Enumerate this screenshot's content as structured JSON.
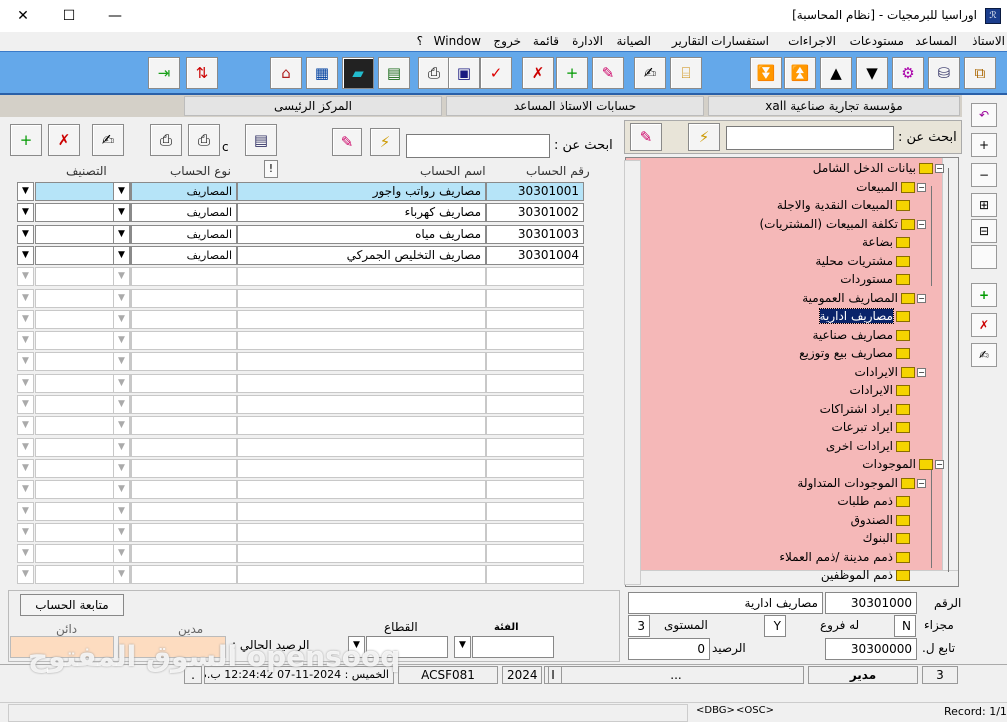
{
  "window": {
    "title": "اوراسيا للبرمجيات - [نظام المحاسبة]",
    "app_icon": "ℛ"
  },
  "menu": [
    "الاستاذ",
    "المساعد",
    "مستودعات",
    "الاجراءات",
    "استفسارات",
    "التقارير",
    "الصيانة",
    "الادارة",
    "قائمة",
    "خروج",
    "Window",
    "؟"
  ],
  "headers": {
    "left": "المركز الرئيسى",
    "middle": "حسابات الاستاذ المساعد",
    "right": "مؤسسة تجارية صناعية xall"
  },
  "search_label_right": "ابحث عن :",
  "search_label_left": "ابحث عن :",
  "print_c": "c",
  "tree": [
    {
      "text": "بيانات الدخل الشامل",
      "level": 0,
      "folder": true
    },
    {
      "text": "المبيعات",
      "level": 1,
      "folder": true
    },
    {
      "text": "المبيعات النقدية والاجلة",
      "level": 2
    },
    {
      "text": "تكلفة المبيعات (المشتريات)",
      "level": 1,
      "folder": true
    },
    {
      "text": "بضاعة",
      "level": 2
    },
    {
      "text": "مشتريات محلية",
      "level": 2
    },
    {
      "text": "مستوردات",
      "level": 2
    },
    {
      "text": "المصاريف العمومية",
      "level": 1,
      "folder": true,
      "open": true
    },
    {
      "text": "مصاريف ادارية",
      "level": 2,
      "selected": true
    },
    {
      "text": "مصاريف صناعية",
      "level": 2
    },
    {
      "text": "مصاريف بيع وتوزيع",
      "level": 2
    },
    {
      "text": "الايرادات",
      "level": 1,
      "folder": true
    },
    {
      "text": "الايرادات",
      "level": 2
    },
    {
      "text": "ايراد اشتراكات",
      "level": 2
    },
    {
      "text": "ايراد تبرعات",
      "level": 2
    },
    {
      "text": "ايرادات اخرى",
      "level": 2
    },
    {
      "text": "الموجودات",
      "level": 0,
      "folder": true
    },
    {
      "text": "الموجودات المتداولة",
      "level": 1,
      "folder": true
    },
    {
      "text": "ذمم طلبات",
      "level": 2
    },
    {
      "text": "الصندوق",
      "level": 2
    },
    {
      "text": "البنوك",
      "level": 2
    },
    {
      "text": "ذمم مدينة /ذمم العملاء",
      "level": 2
    },
    {
      "text": "ذمم الموظفين",
      "level": 2
    }
  ],
  "grid": {
    "columns": {
      "number": "رقم الحساب",
      "name": "اسم الحساب",
      "type": "نوع الحساب",
      "class": "التصنيف"
    },
    "excl": "!",
    "rows": [
      {
        "number": "30301001",
        "name": "مصاريف رواتب واجور",
        "type": "المصاريف"
      },
      {
        "number": "30301002",
        "name": "مصاريف كهرباء",
        "type": "المصاريف"
      },
      {
        "number": "30301003",
        "name": "مصاريف مياه",
        "type": "المصاريف"
      },
      {
        "number": "30301004",
        "name": "مصاريف التخليص الجمركي",
        "type": "المصاريف"
      }
    ],
    "empty_rows": 15
  },
  "info": {
    "number_label": "الرقم",
    "number_value": "30301000",
    "name_value": "مصاريف ادارية",
    "split_label": "مجزاء",
    "split_value": "N",
    "branches_label": "له فروع",
    "branches_value": "Y",
    "level_label": "المستوى",
    "level_value": "3",
    "parent_label": "تابع ل.",
    "parent_value": "30300000",
    "balance_label": "الرصيد",
    "balance_value": "0"
  },
  "follow_button": "متابعة الحساب",
  "category_label": "الفئة",
  "sector_label": "القطاع",
  "debit_label": "مدين",
  "credit_label": "دائن",
  "current_balance_label": "الرصيد الحالي :",
  "status": {
    "num": "3",
    "role": "مدير",
    "dots": "...",
    "sep": "I",
    "year": "2024",
    "code": "ACSF081",
    "datetime": "الخميس : 2024-11-07 12:24:42 ب.ظ",
    "dot": "."
  },
  "bottom": {
    "dbg": "<DBG>",
    "osc": "<OSC>",
    "record": "Record: 1/1"
  },
  "watermark": "السوق المفتوح opensooq"
}
